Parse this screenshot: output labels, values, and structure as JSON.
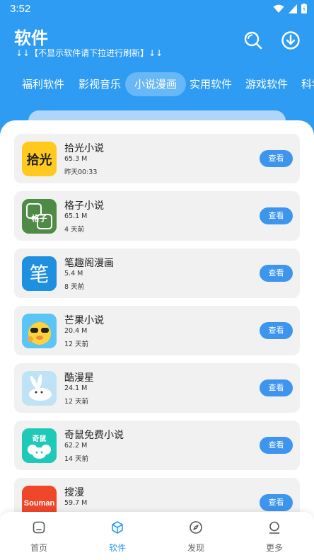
{
  "status": {
    "time": "3:52"
  },
  "header": {
    "title": "软件",
    "subtitle": "↓↓【不显示软件请下拉进行刷新】↓↓",
    "search_icon": "search-icon",
    "download_icon": "download-icon"
  },
  "tabs": [
    {
      "label": "福利软件",
      "active": false
    },
    {
      "label": "影视音乐",
      "active": false
    },
    {
      "label": "小说漫画",
      "active": true
    },
    {
      "label": "实用软件",
      "active": false
    },
    {
      "label": "游戏软件",
      "active": false
    },
    {
      "label": "科学",
      "active": false
    }
  ],
  "apps": [
    {
      "name": "拾光小说",
      "size": "65.3 M",
      "time": "昨天00:33",
      "button": "查看",
      "icon_text": "拾光"
    },
    {
      "name": "格子小说",
      "size": "65.1 M",
      "time": "4 天前",
      "button": "查看",
      "icon_text": "格子"
    },
    {
      "name": "笔趣阁漫画",
      "size": "5.4 M",
      "time": "8 天前",
      "button": "查看",
      "icon_text": "笔"
    },
    {
      "name": "芒果小说",
      "size": "20.4 M",
      "time": "12 天前",
      "button": "查看",
      "icon_text": ""
    },
    {
      "name": "酷漫星",
      "size": "24.1 M",
      "time": "12 天前",
      "button": "查看",
      "icon_text": ""
    },
    {
      "name": "奇鼠免费小说",
      "size": "62.2 M",
      "time": "14 天前",
      "button": "查看",
      "icon_text": "奇鼠"
    },
    {
      "name": "搜漫",
      "size": "59.7 M",
      "time": "",
      "button": "查看",
      "icon_text": "Souman"
    }
  ],
  "bottom_nav": [
    {
      "label": "首页",
      "icon": "home-icon",
      "active": false
    },
    {
      "label": "软件",
      "icon": "cube-icon",
      "active": true
    },
    {
      "label": "发现",
      "icon": "compass-icon",
      "active": false
    },
    {
      "label": "更多",
      "icon": "profile-icon",
      "active": false
    }
  ],
  "colors": {
    "primary": "#2f9cf3",
    "button": "#3d95ee",
    "card": "#f1f1f1"
  }
}
